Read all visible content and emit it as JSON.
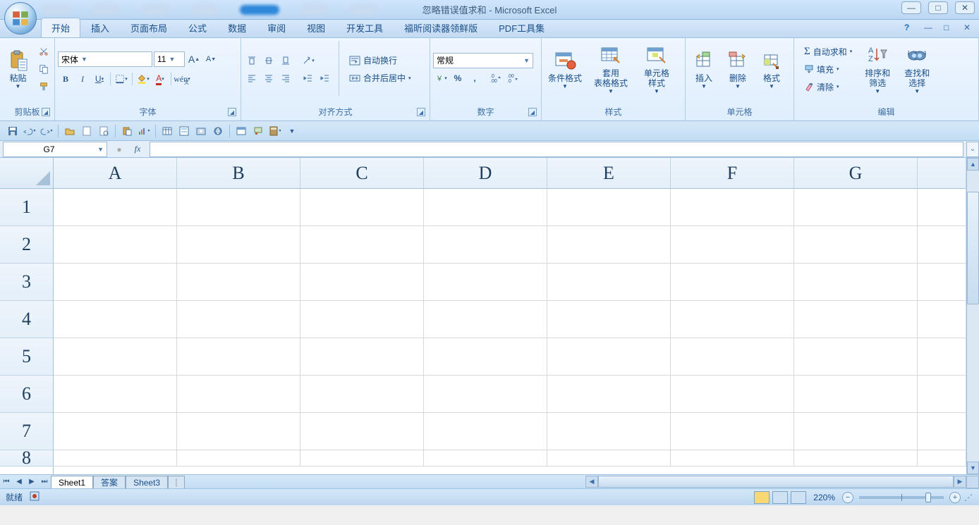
{
  "title": {
    "doc": "忽略错误值求和",
    "app": "Microsoft Excel"
  },
  "window_buttons": {
    "min": "—",
    "max": "□",
    "close": "✕"
  },
  "tabs": {
    "items": [
      "开始",
      "插入",
      "页面布局",
      "公式",
      "数据",
      "审阅",
      "视图",
      "开发工具",
      "福昕阅读器领鲜版",
      "PDF工具集"
    ],
    "active_index": 0,
    "ribbon_min": "—",
    "ribbon_max": "□",
    "ribbon_close": "✕",
    "help": "?"
  },
  "ribbon": {
    "clipboard": {
      "paste": "粘贴",
      "label": "剪贴板"
    },
    "font": {
      "name": "宋体",
      "size": "11",
      "bold": "B",
      "italic": "I",
      "underline": "U",
      "label": "字体",
      "grow": "A",
      "shrink": "A"
    },
    "align": {
      "wrap": "自动换行",
      "merge": "合并后居中",
      "label": "对齐方式"
    },
    "number": {
      "format": "常规",
      "label": "数字"
    },
    "styles": {
      "cond": "条件格式",
      "table": "套用\n表格格式",
      "cell": "单元格\n样式",
      "label": "样式"
    },
    "cells": {
      "insert": "插入",
      "delete": "删除",
      "format": "格式",
      "label": "单元格"
    },
    "editing": {
      "sum": "自动求和",
      "fill": "填充",
      "clear": "清除",
      "sort": "排序和\n筛选",
      "find": "查找和\n选择",
      "label": "编辑"
    }
  },
  "formula": {
    "cell_ref": "G7",
    "fx": "fx"
  },
  "grid": {
    "columns": [
      "A",
      "B",
      "C",
      "D",
      "E",
      "F",
      "G"
    ],
    "rows": [
      "1",
      "2",
      "3",
      "4",
      "5",
      "6",
      "7",
      "8"
    ]
  },
  "sheets": {
    "tabs": [
      "Sheet1",
      "答案",
      "Sheet3"
    ],
    "active_index": 0
  },
  "status": {
    "ready": "就绪",
    "zoom": "220%"
  }
}
